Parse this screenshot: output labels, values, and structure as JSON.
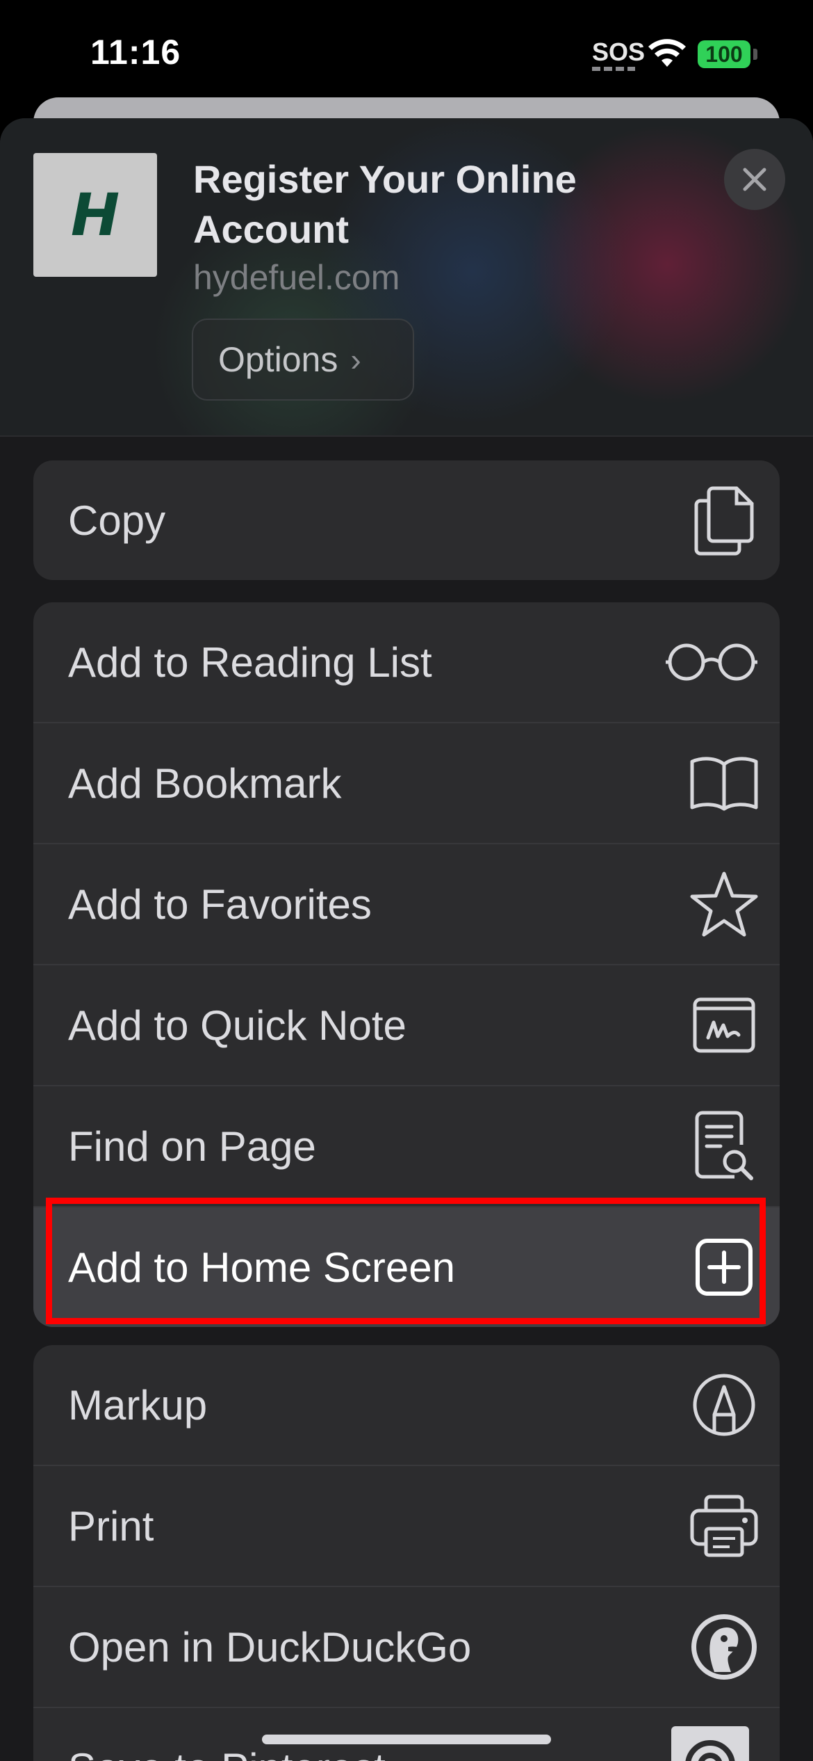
{
  "status": {
    "time": "11:16",
    "sos": "SOS",
    "battery": "100"
  },
  "header": {
    "icon_letter": "H",
    "title": "Register Your Online Account",
    "domain": "hydefuel.com",
    "options_label": "Options"
  },
  "groups": {
    "first": [
      {
        "label": "Copy",
        "icon": "copy-icon"
      }
    ],
    "second": [
      {
        "label": "Add to Reading List",
        "icon": "glasses-icon"
      },
      {
        "label": "Add Bookmark",
        "icon": "book-icon"
      },
      {
        "label": "Add to Favorites",
        "icon": "star-icon"
      },
      {
        "label": "Add to Quick Note",
        "icon": "quick-note-icon"
      },
      {
        "label": "Find on Page",
        "icon": "find-document-icon"
      },
      {
        "label": "Add to Home Screen",
        "icon": "plus-square-icon",
        "highlighted": true
      }
    ],
    "third": [
      {
        "label": "Markup",
        "icon": "markup-pen-icon"
      },
      {
        "label": "Print",
        "icon": "printer-icon"
      },
      {
        "label": "Open in DuckDuckGo",
        "icon": "duckduckgo-icon"
      },
      {
        "label": "Save to Pinterest",
        "icon": "pinterest-icon"
      }
    ]
  },
  "colors": {
    "highlight_border": "#ff0000",
    "battery": "#30d158",
    "row_background": "#2c2c2e"
  }
}
